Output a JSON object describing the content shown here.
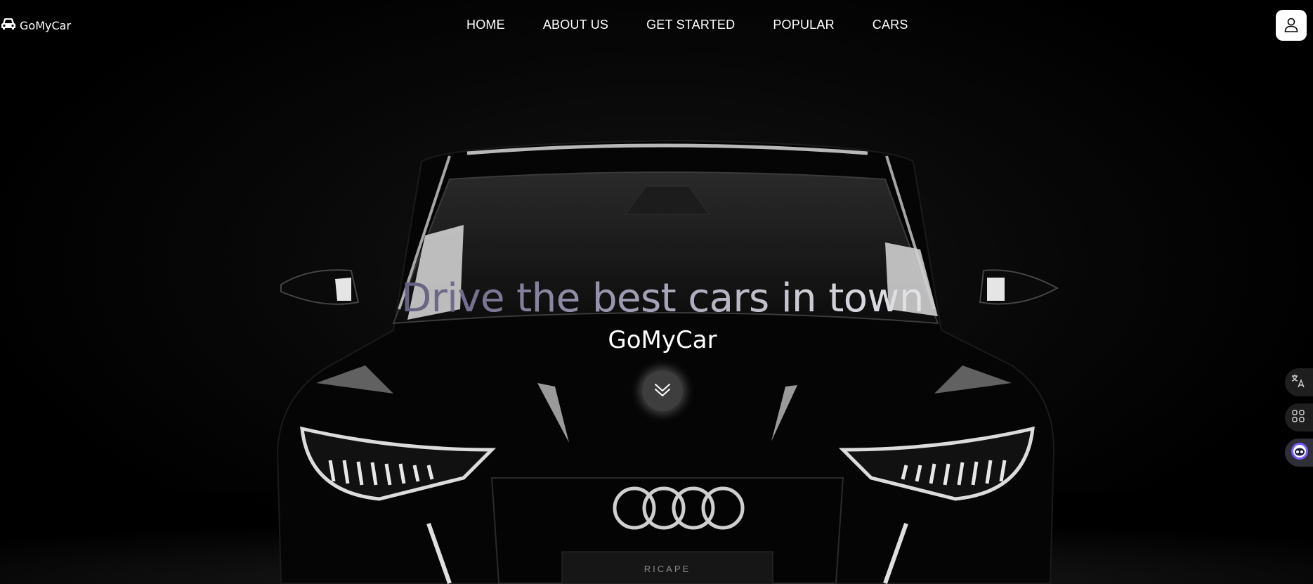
{
  "brand": {
    "name": "GoMyCar",
    "icon": "car-icon"
  },
  "nav": {
    "items": [
      {
        "label": "HOME"
      },
      {
        "label": "ABOUT US"
      },
      {
        "label": "GET STARTED"
      },
      {
        "label": "POPULAR"
      },
      {
        "label": "CARS"
      }
    ]
  },
  "account": {
    "icon": "user-icon"
  },
  "hero": {
    "headline": "Drive the best cars in town",
    "subtitle": "GoMyCar",
    "scroll_icon": "double-chevron-down-icon",
    "plate_text": "RICAPE"
  },
  "side_tools": [
    {
      "icon": "translate-icon"
    },
    {
      "icon": "apps-grid-icon"
    },
    {
      "icon": "ai-assistant-icon"
    }
  ],
  "colors": {
    "background": "#000000",
    "nav_text": "#ffffff",
    "headline_gradient_start": "#6d6a86",
    "headline_gradient_end": "#e3e3e8",
    "user_button_bg": "#ffffff"
  }
}
